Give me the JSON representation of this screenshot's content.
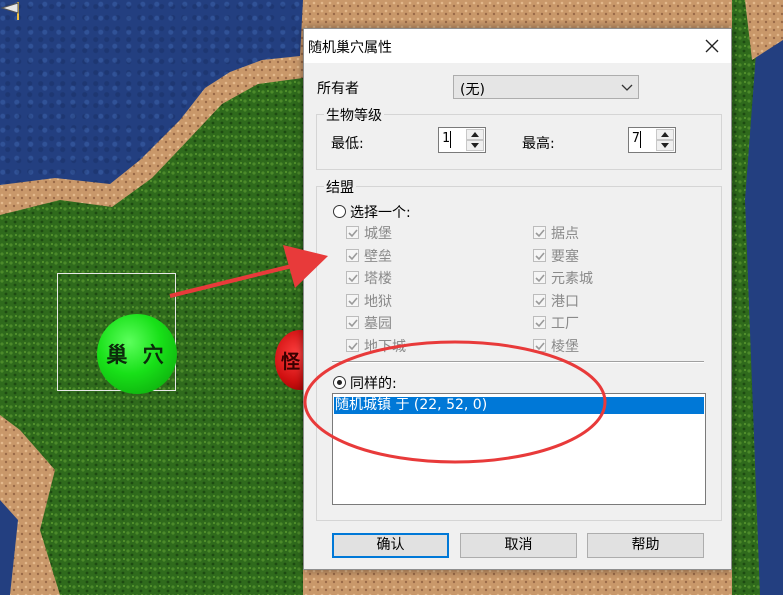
{
  "map": {
    "nest_label": "巢 穴",
    "monster_label": "怪"
  },
  "dialog": {
    "title": "随机巢穴属性",
    "owner_label": "所有者",
    "owner_value": "(无)",
    "level_group": "生物等级",
    "min_label": "最低:",
    "min_value": "1",
    "max_label": "最高:",
    "max_value": "7",
    "alignment_group": "结盟",
    "choose_one_label": "选择一个:",
    "choose_one_selected": false,
    "towns_left": [
      {
        "label": "城堡",
        "checked": true
      },
      {
        "label": "壁垒",
        "checked": true
      },
      {
        "label": "塔楼",
        "checked": true
      },
      {
        "label": "地狱",
        "checked": true
      },
      {
        "label": "墓园",
        "checked": true
      },
      {
        "label": "地下城",
        "checked": true
      }
    ],
    "towns_right": [
      {
        "label": "据点",
        "checked": true
      },
      {
        "label": "要塞",
        "checked": true
      },
      {
        "label": "元素城",
        "checked": true
      },
      {
        "label": "港口",
        "checked": true
      },
      {
        "label": "工厂",
        "checked": true
      },
      {
        "label": "棱堡",
        "checked": true
      }
    ],
    "same_as_label": "同样的:",
    "same_as_selected": true,
    "same_as_items": [
      "随机城镇 于 (22, 52, 0)"
    ],
    "ok_label": "确认",
    "cancel_label": "取消",
    "help_label": "帮助"
  },
  "colors": {
    "selection": "#0078d7",
    "annotation": "#e83a3a",
    "nest": "#19d019",
    "water": "#233f80",
    "grass": "#2f6a1c",
    "sand": "#c9986a"
  }
}
